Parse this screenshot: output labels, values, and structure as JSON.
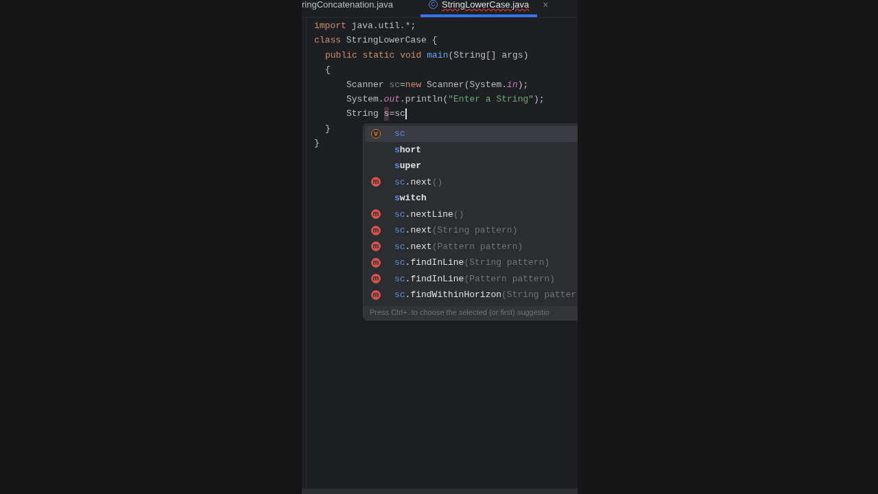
{
  "tabs": [
    {
      "label": "ringConcatenation.java",
      "selected": false
    },
    {
      "label": "StringLowerCase.java",
      "selected": true,
      "icon_letter": "C",
      "close": "×"
    }
  ],
  "code": [
    {
      "tokens": [
        {
          "kind": "keyword",
          "text": "import"
        },
        {
          "kind": "plain",
          "text": " java.util.*;"
        }
      ]
    },
    {
      "tokens": [
        {
          "kind": "keyword",
          "text": "class"
        },
        {
          "kind": "plain",
          "text": " StringLowerCase {"
        }
      ],
      "children": [
        {
          "tokens": [
            {
              "kind": "keyword",
              "text": "public static void "
            },
            {
              "kind": "method",
              "text": "main"
            },
            {
              "kind": "plain",
              "text": "(String[] args)"
            }
          ]
        },
        {
          "tokens": [
            {
              "kind": "plain",
              "text": "{"
            }
          ],
          "children": [
            {
              "tokens": [
                {
                  "kind": "plain",
                  "text": "Scanner "
                },
                {
                  "kind": "unused",
                  "text": "sc"
                },
                {
                  "kind": "plain",
                  "text": "="
                },
                {
                  "kind": "keyword",
                  "text": "new"
                },
                {
                  "kind": "plain",
                  "text": " Scanner(System."
                },
                {
                  "kind": "field",
                  "text": "in"
                },
                {
                  "kind": "plain",
                  "text": ");"
                }
              ]
            },
            {
              "tokens": [
                {
                  "kind": "plain",
                  "text": "System."
                },
                {
                  "kind": "field",
                  "text": "out"
                },
                {
                  "kind": "plain",
                  "text": ".println("
                },
                {
                  "kind": "string",
                  "text": "\"Enter a String\""
                },
                {
                  "kind": "plain",
                  "text": ");"
                }
              ]
            },
            {
              "tokens": [
                {
                  "kind": "plain",
                  "text": "String "
                },
                {
                  "kind": "highlight",
                  "text": "s"
                },
                {
                  "kind": "plain",
                  "text": "=sc"
                }
              ],
              "caret": true
            }
          ]
        },
        {
          "tokens": [
            {
              "kind": "plain",
              "text": "}"
            }
          ]
        }
      ]
    },
    {
      "tokens": [
        {
          "kind": "plain",
          "text": "}"
        }
      ]
    }
  ],
  "completion": {
    "items": [
      {
        "kind": "variable",
        "icon_letter": "v",
        "match": "sc",
        "selected": true
      },
      {
        "kind": "keyword",
        "match": "s",
        "rest": "hort",
        "selected": false
      },
      {
        "kind": "keyword",
        "match": "s",
        "rest": "uper",
        "selected": false
      },
      {
        "kind": "method",
        "icon_letter": "m",
        "match": "sc",
        "rest": ".next",
        "params": "()",
        "selected": false
      },
      {
        "kind": "keyword",
        "match": "s",
        "rest": "witch",
        "selected": false
      },
      {
        "kind": "method",
        "icon_letter": "m",
        "match": "sc",
        "rest": ".nextLine",
        "params": "()",
        "selected": false
      },
      {
        "kind": "method",
        "icon_letter": "m",
        "match": "sc",
        "rest": ".next",
        "params": "(String pattern)",
        "selected": false
      },
      {
        "kind": "method",
        "icon_letter": "m",
        "match": "sc",
        "rest": ".next",
        "params": "(Pattern pattern)",
        "selected": false
      },
      {
        "kind": "method",
        "icon_letter": "m",
        "match": "sc",
        "rest": ".findInLine",
        "params": "(String pattern)",
        "selected": false
      },
      {
        "kind": "method",
        "icon_letter": "m",
        "match": "sc",
        "rest": ".findInLine",
        "params": "(Pattern pattern)",
        "selected": false
      },
      {
        "kind": "method",
        "icon_letter": "m",
        "match": "sc",
        "rest": ".findWithinHorizon",
        "params": "(String patter",
        "selected": false
      }
    ],
    "hint": "Press Ctrl+. to choose the selected (or first) suggestio"
  }
}
